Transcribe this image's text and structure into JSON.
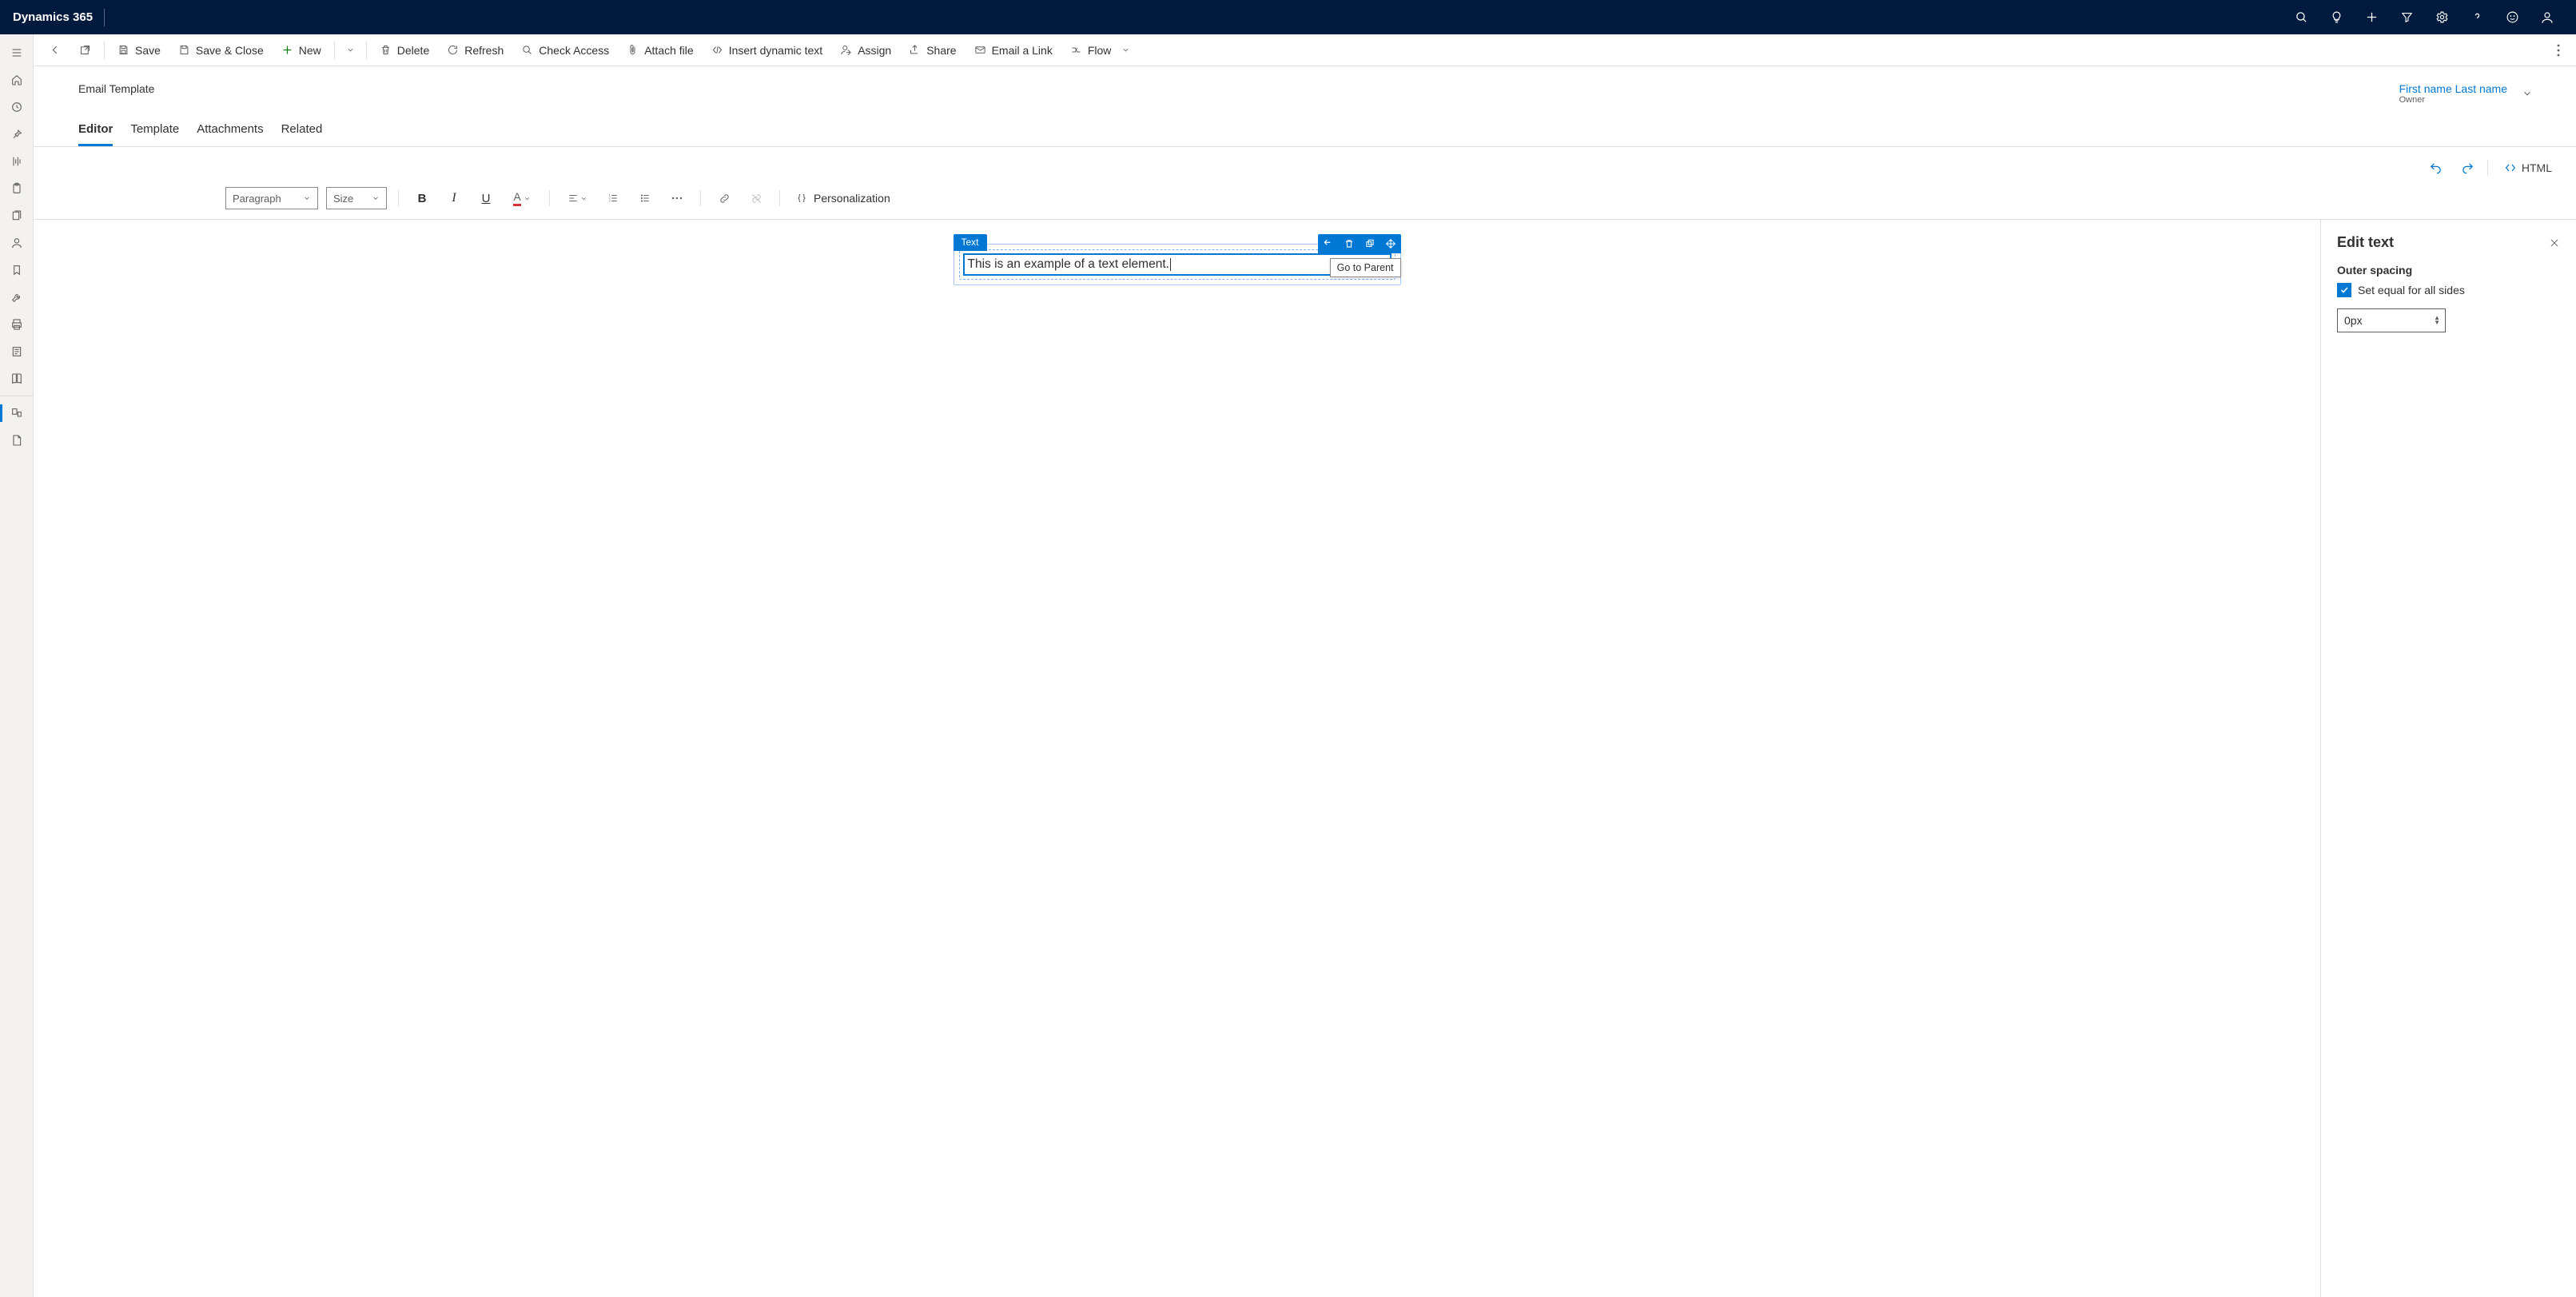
{
  "topbar": {
    "title": "Dynamics 365"
  },
  "cmdbar": {
    "save": "Save",
    "save_close": "Save & Close",
    "new": "New",
    "delete": "Delete",
    "refresh": "Refresh",
    "check_access": "Check Access",
    "attach_file": "Attach file",
    "insert_dynamic": "Insert dynamic text",
    "assign": "Assign",
    "share": "Share",
    "email_link": "Email a Link",
    "flow": "Flow"
  },
  "record": {
    "entity": "Email Template",
    "owner_name": "First name Last name",
    "owner_label": "Owner"
  },
  "tabs": [
    "Editor",
    "Template",
    "Attachments",
    "Related"
  ],
  "active_tab": "Editor",
  "editorbar": {
    "html": "HTML"
  },
  "rttoolbar": {
    "paragraph": "Paragraph",
    "size": "Size",
    "personalization": "Personalization"
  },
  "canvas": {
    "badge": "Text",
    "text": "This is an example of a text element.",
    "tooltip": "Go to Parent"
  },
  "sidepanel": {
    "title": "Edit text",
    "outer_spacing": "Outer spacing",
    "set_equal": "Set equal for all sides",
    "spacing_value": "0px"
  }
}
